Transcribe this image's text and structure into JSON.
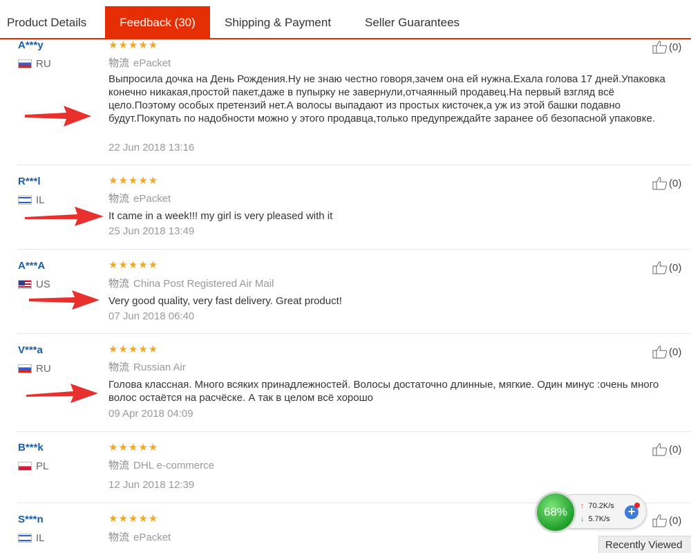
{
  "tabs": [
    {
      "label": "Product Details",
      "active": false
    },
    {
      "label": "Feedback (30)",
      "active": true
    },
    {
      "label": "Shipping & Payment",
      "active": false
    },
    {
      "label": "Seller Guarantees",
      "active": false
    }
  ],
  "logistics_prefix": "物流",
  "stars_glyph": "★★★★★",
  "reviews": [
    {
      "buyer": "A***y",
      "country": "RU",
      "rating": 5,
      "logistics": "ePacket",
      "text": "Выпросила дочка на День Рождения.Ну не знаю честно говоря,зачем она ей нужна.Ехала голова 17 дней.Упаковка конечно никакая,простой пакет,даже в пупырку не завернули,отчаянный продавец.На первый взгляд всё цело.Поэтому особых претензий нет.А волосы выпадают из простых кисточек,а уж из этой башки подавно будут.Покупать по надобности можно у этого продавца,только предупреждайте заранее об безопасной упаковке.",
      "date": "22 Jun 2018 13:16",
      "helpful": "(0)"
    },
    {
      "buyer": "R***l",
      "country": "IL",
      "rating": 5,
      "logistics": "ePacket",
      "text": "It came in a week!!! my girl is very pleased with it",
      "date": "25 Jun 2018 13:49",
      "helpful": "(0)"
    },
    {
      "buyer": "A***A",
      "country": "US",
      "rating": 5,
      "logistics": "China Post Registered Air Mail",
      "text": "Very good quality, very fast delivery. Great product!",
      "date": "07 Jun 2018 06:40",
      "helpful": "(0)"
    },
    {
      "buyer": "V***a",
      "country": "RU",
      "rating": 5,
      "logistics": "Russian Air",
      "text": "Голова классная. Много всяких принадлежностей. Волосы достаточно длинные, мягкие. Один минус :очень много волос остаётся на расчёске. А так в целом всё хорошо",
      "date": "09 Apr 2018 04:09",
      "helpful": "(0)"
    },
    {
      "buyer": "B***k",
      "country": "PL",
      "rating": 5,
      "logistics": "DHL e-commerce",
      "text": "",
      "date": "12 Jun 2018 12:39",
      "helpful": "(0)"
    },
    {
      "buyer": "S***n",
      "country": "IL",
      "rating": 5,
      "logistics": "ePacket",
      "text": "",
      "date": "",
      "helpful": "(0)"
    }
  ],
  "widget": {
    "percent": "68%",
    "upload_speed": "70.2K/s",
    "download_speed": "5.7K/s",
    "plus_label": "+"
  },
  "recently_viewed": "Recently Viewed",
  "colors": {
    "accent": "#e62e04",
    "buyer_name": "#1a5ea8",
    "star": "#f5a623",
    "annotation_arrow": "#e8312f"
  }
}
